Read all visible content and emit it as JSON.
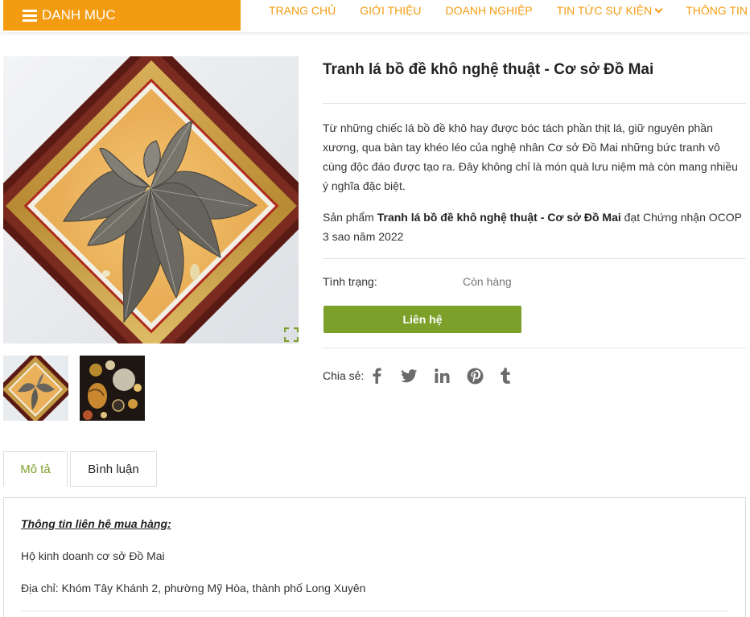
{
  "nav": {
    "category_label": "DANH MỤC",
    "items": [
      {
        "label": "TRANG CHỦ",
        "dropdown": false
      },
      {
        "label": "GIỚI THIỆU",
        "dropdown": false
      },
      {
        "label": "DOANH NGHIỆP",
        "dropdown": false
      },
      {
        "label": "TIN TỨC SỰ KIỆN",
        "dropdown": true
      },
      {
        "label": "THÔNG TIN",
        "dropdown": true
      }
    ]
  },
  "product": {
    "title": "Tranh lá bồ đề khô nghệ thuật - Cơ sở Đồ Mai",
    "description": "Từ những chiếc lá bồ đề khô hay được bóc tách phần thịt lá, giữ nguyên phần xương, qua bàn tay khéo léo của nghệ nhân Cơ sở Đồ Mai những bức tranh vô cùng độc đáo được tạo ra. Đây không chỉ là món quà lưu niệm mà còn mang nhiều ý nghĩa đặc biệt.",
    "cert_prefix": "Sản phẩm ",
    "cert_name": "Tranh lá bồ đề khô nghệ thuật - Cơ sở Đồ Mai",
    "cert_suffix": " đạt Chứng nhận OCOP 3 sao năm 2022",
    "status_label": "Tình trạng:",
    "status_value": "Còn hàng",
    "contact_label": "Liên hệ",
    "share_label": "Chia sẻ:"
  },
  "tabs": [
    {
      "label": "Mô tả",
      "active": true
    },
    {
      "label": "Bình luận",
      "active": false
    }
  ],
  "panel": {
    "heading": "Thông tin liên hệ mua hàng:",
    "business": "Hộ kinh doanh cơ sở Đồ Mai",
    "address": "Địa chỉ: Khóm Tây Khánh 2, phường Mỹ Hòa, thành phố Long Xuyên"
  },
  "colors": {
    "accent_orange": "#f39c12",
    "accent_green": "#7da02b"
  },
  "icons": [
    "hamburger-icon",
    "chevron-down-icon",
    "expand-icon",
    "facebook-icon",
    "twitter-icon",
    "linkedin-icon",
    "pinterest-icon",
    "tumblr-icon"
  ]
}
